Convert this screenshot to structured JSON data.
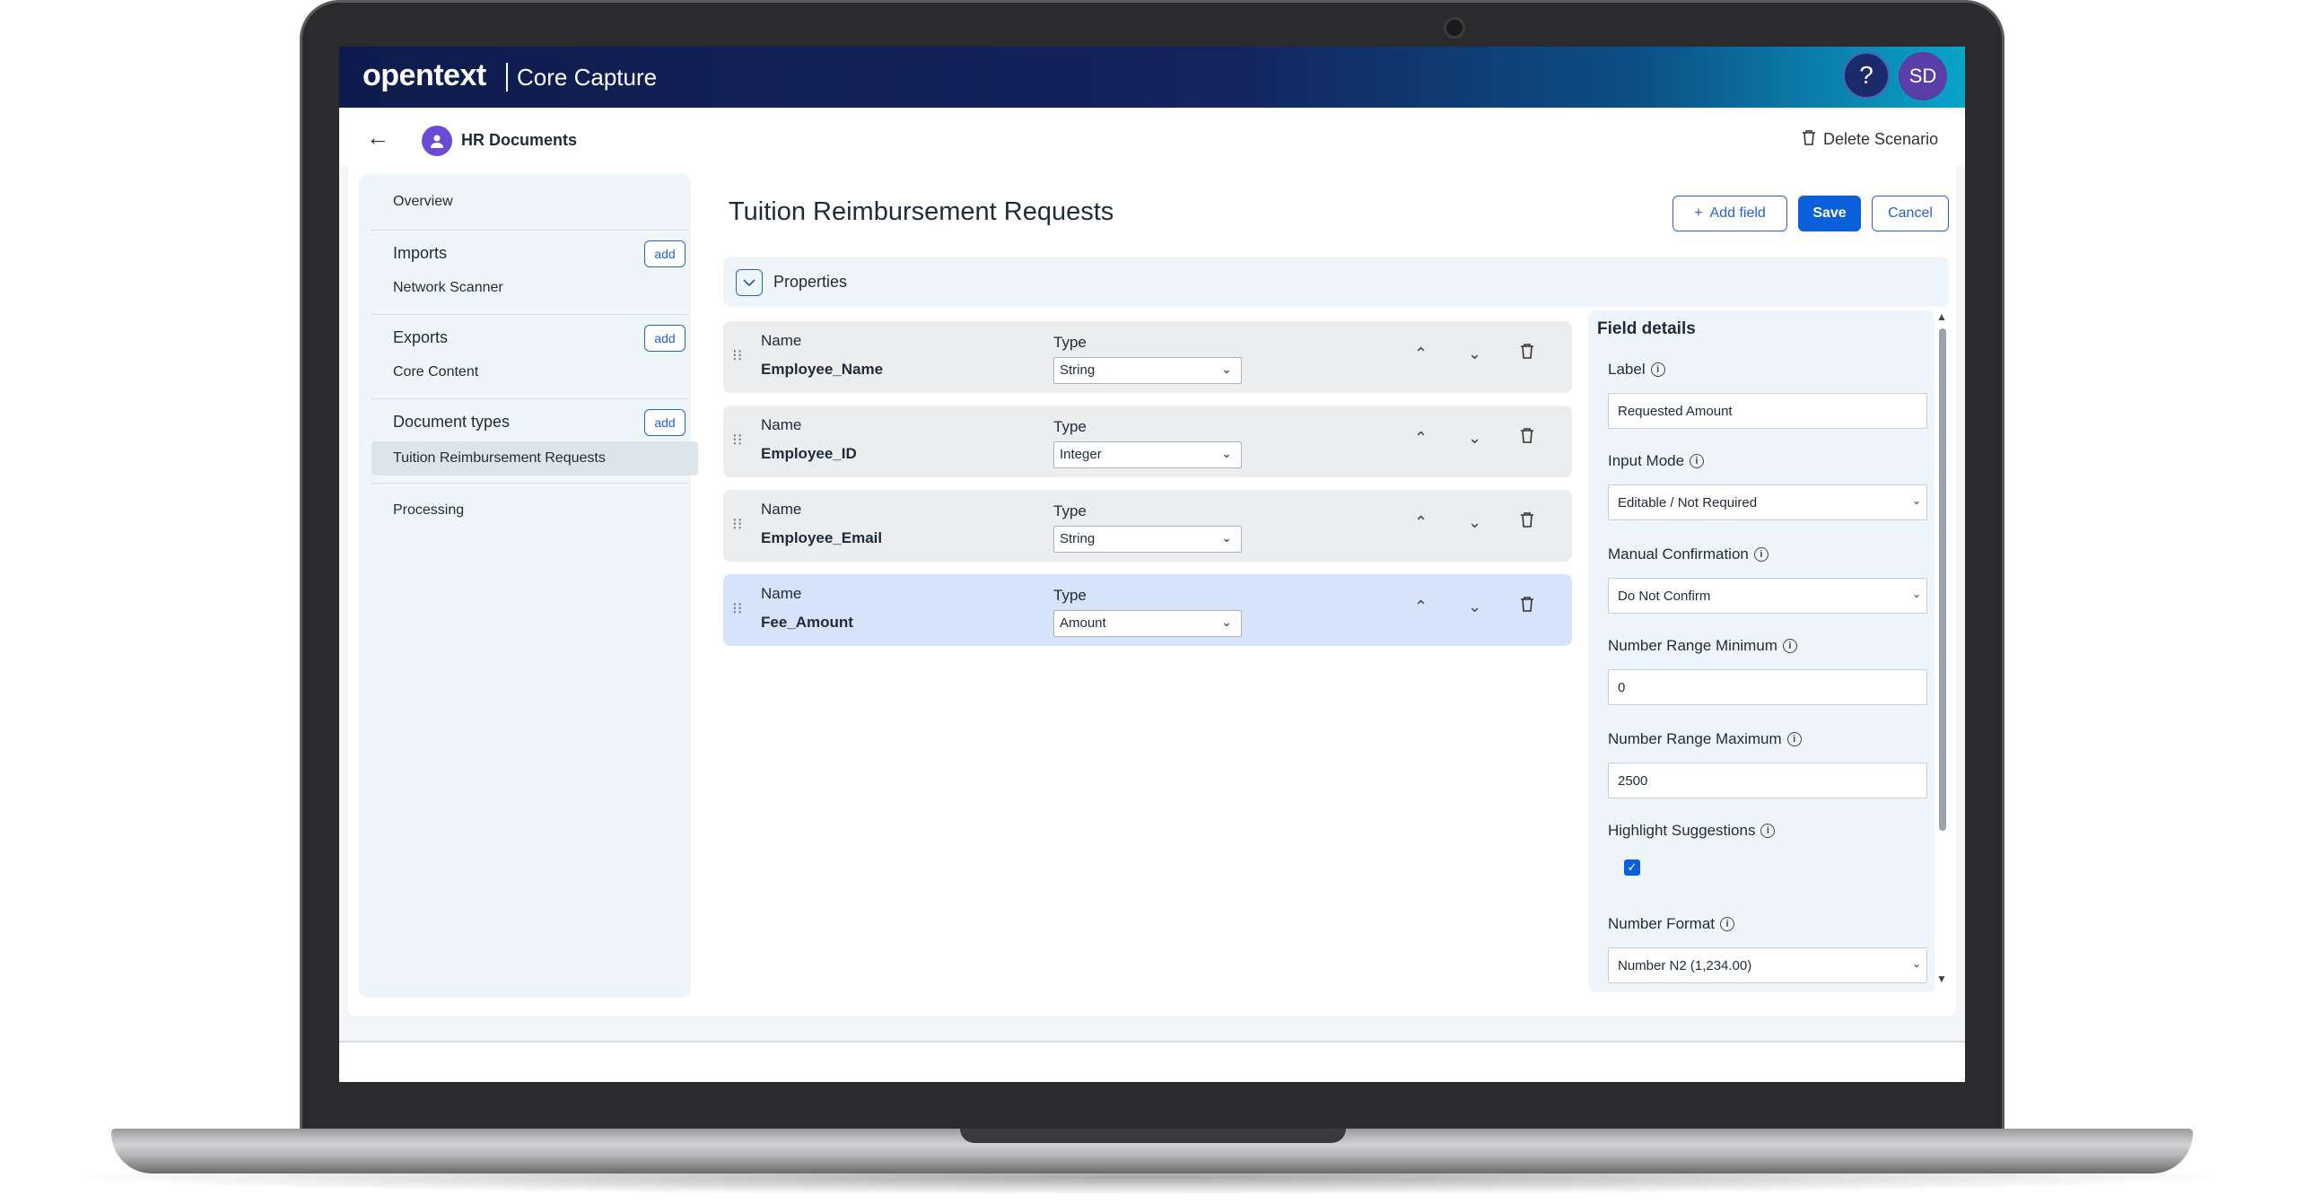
{
  "header": {
    "brand": "opentext",
    "product": "Core Capture",
    "help_label": "?",
    "avatar_initials": "SD"
  },
  "subheader": {
    "title": "HR Documents",
    "delete_label": "Delete Scenario"
  },
  "sidebar": {
    "overview": "Overview",
    "imports": {
      "label": "Imports",
      "add": "add",
      "items": [
        "Network Scanner"
      ]
    },
    "exports": {
      "label": "Exports",
      "add": "add",
      "items": [
        "Core Content"
      ]
    },
    "document_types": {
      "label": "Document types",
      "add": "add",
      "items": [
        "Tuition Reimbursement Requests"
      ]
    },
    "processing": "Processing"
  },
  "main": {
    "title": "Tuition Reimbursement Requests",
    "add_field": "Add field",
    "save": "Save",
    "cancel": "Cancel",
    "properties": "Properties",
    "name_label": "Name",
    "type_label": "Type",
    "fields": [
      {
        "name": "Employee_Name",
        "type": "String"
      },
      {
        "name": "Employee_ID",
        "type": "Integer"
      },
      {
        "name": "Employee_Email",
        "type": "String"
      },
      {
        "name": "Fee_Amount",
        "type": "Amount"
      }
    ]
  },
  "details": {
    "title": "Field details",
    "label": {
      "label": "Label",
      "value": "Requested Amount"
    },
    "input_mode": {
      "label": "Input Mode",
      "value": "Editable / Not Required"
    },
    "manual_confirmation": {
      "label": "Manual Confirmation",
      "value": "Do Not Confirm"
    },
    "range_min": {
      "label": "Number Range Minimum",
      "value": "0"
    },
    "range_max": {
      "label": "Number Range Maximum",
      "value": "2500"
    },
    "highlight": {
      "label": "Highlight Suggestions",
      "checked": true
    },
    "number_format": {
      "label": "Number Format",
      "value": "Number N2 (1,234.00)"
    }
  },
  "colors": {
    "accent": "#0b5fd8",
    "header_start": "#0e1b4d",
    "header_end": "#0aa4c8",
    "panel_bg": "#eef6fb",
    "active_row": "#d6e3fb"
  }
}
